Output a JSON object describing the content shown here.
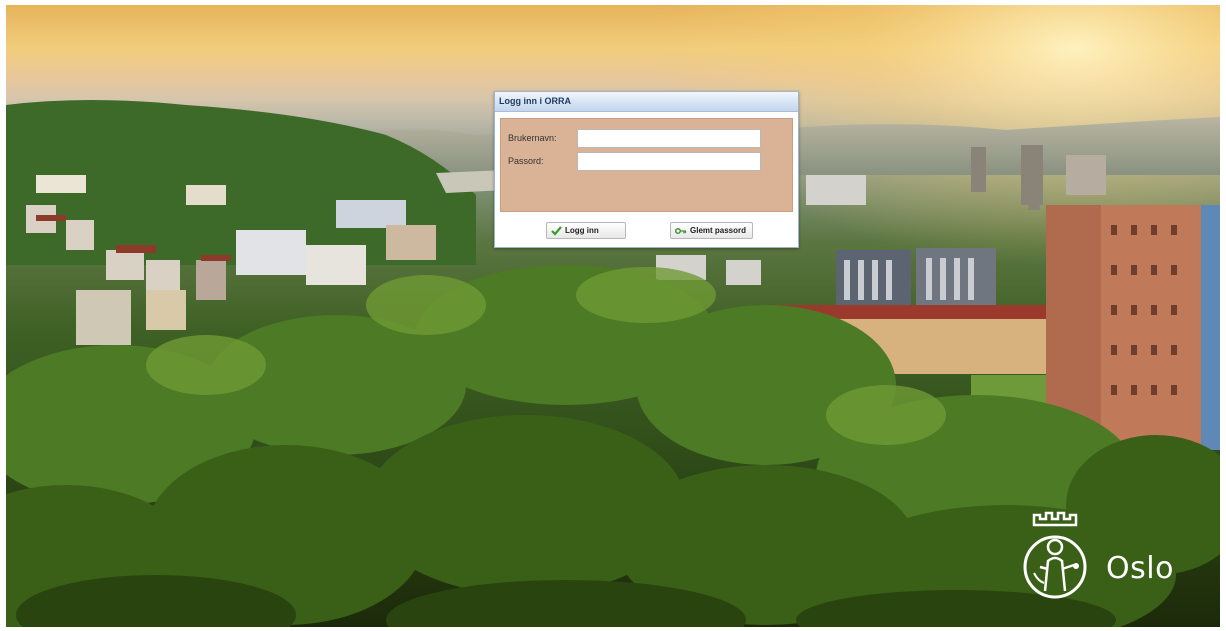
{
  "dialog": {
    "title": "Logg inn i ORRA",
    "username_label": "Brukernavn:",
    "username_value": "",
    "password_label": "Passord:",
    "password_value": "",
    "login_button": "Logg inn",
    "login_icon": "check-icon",
    "forgot_button": "Glemt passord",
    "forgot_icon": "key-icon"
  },
  "branding": {
    "logo_text": "Oslo",
    "logo_icon": "oslo-city-seal"
  },
  "colors": {
    "form_bg": "#dab296",
    "titlebar": "#d6e3f4",
    "check_green": "#3a9a2a",
    "key_green": "#4e8f3a"
  }
}
